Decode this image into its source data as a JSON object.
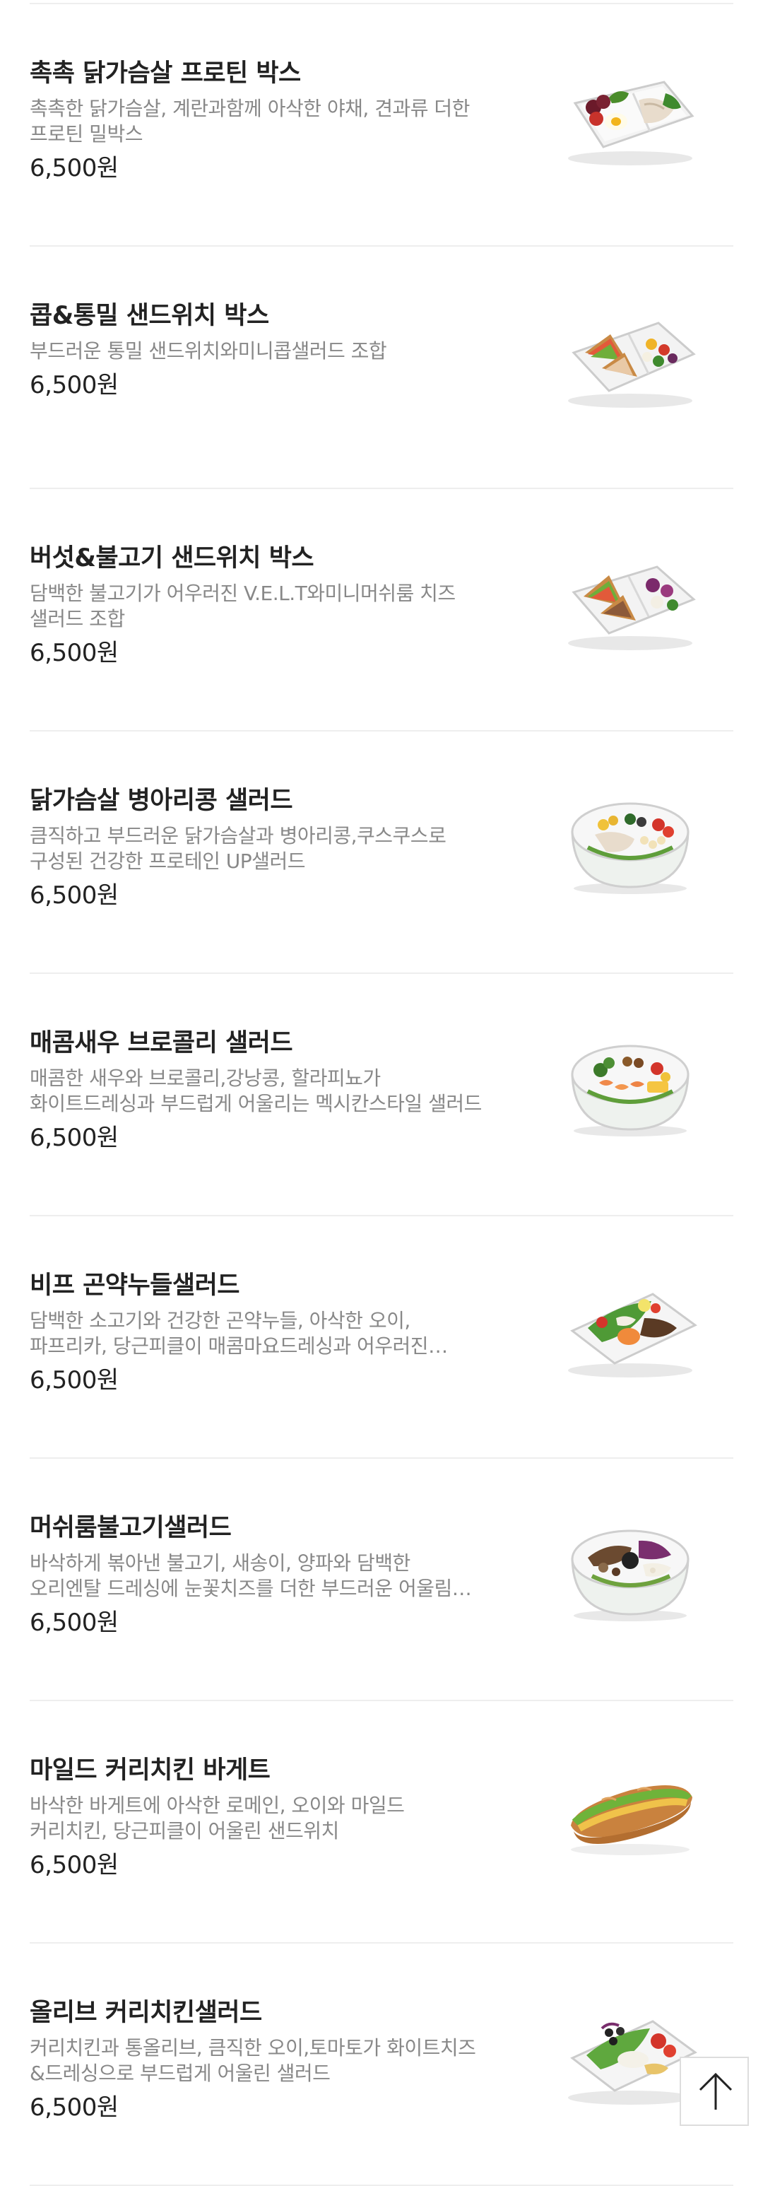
{
  "menu_items": [
    {
      "name": "촉촉 닭가슴살 프로틴 박스",
      "description": "촉촉한 닭가슴살, 계란과함께 아삭한 야채, 견과류 더한 프로틴 밀박스",
      "price": "6,500원",
      "image_icon": "protein-box-icon"
    },
    {
      "name": "콥&통밀 샌드위치 박스",
      "description": "부드러운 통밀 샌드위치와미니콥샐러드 조합",
      "price": "6,500원",
      "image_icon": "sandwich-box-icon"
    },
    {
      "name": "버섯&불고기 샌드위치 박스",
      "description": "담백한 불고기가 어우러진 V.E.L.T와미니머쉬룸 치즈 샐러드 조합",
      "price": "6,500원",
      "image_icon": "sandwich-box-icon"
    },
    {
      "name": "닭가슴살 병아리콩 샐러드",
      "description": "큼직하고 부드러운 닭가슴살과 병아리콩,쿠스쿠스로 구성된 건강한 프로테인 UP샐러드",
      "price": "6,500원",
      "image_icon": "salad-bowl-icon"
    },
    {
      "name": "매콤새우 브로콜리 샐러드",
      "description": "매콤한 새우와 브로콜리,강낭콩, 할라피뇨가 화이트드레싱과 부드럽게 어울리는 멕시칸스타일 샐러드",
      "price": "6,500원",
      "image_icon": "salad-bowl-icon"
    },
    {
      "name": "비프 곤약누들샐러드",
      "description": "담백한 소고기와 건강한 곤약누들, 아삭한 오이, 파프리카, 당근피클이 매콤마요드레싱과 어우러진 샐러드",
      "price": "6,500원",
      "image_icon": "salad-tray-icon"
    },
    {
      "name": "머쉬룸불고기샐러드",
      "description": "바삭하게 볶아낸 불고기, 새송이, 양파와 담백한 오리엔탈 드레싱에 눈꽃치즈를 더한 부드러운 어울림 샐러드",
      "price": "6,500원",
      "image_icon": "salad-bowl-icon"
    },
    {
      "name": "마일드 커리치킨 바게트",
      "description": "바삭한 바게트에 아삭한 로메인, 오이와 마일드 커리치킨, 당근피클이 어울린 샌드위치",
      "price": "6,500원",
      "image_icon": "baguette-icon"
    },
    {
      "name": "올리브 커리치킨샐러드",
      "description": "커리치킨과 통올리브, 큼직한 오이,토마토가 화이트치즈&드레싱으로 부드럽게 어울린 샐러드",
      "price": "6,500원",
      "image_icon": "salad-tray-icon"
    }
  ],
  "scroll_top_button": {
    "icon": "arrow-up-icon"
  },
  "colors": {
    "title": "#222222",
    "description": "#888888",
    "divider": "#eeeeee",
    "background": "#ffffff"
  }
}
